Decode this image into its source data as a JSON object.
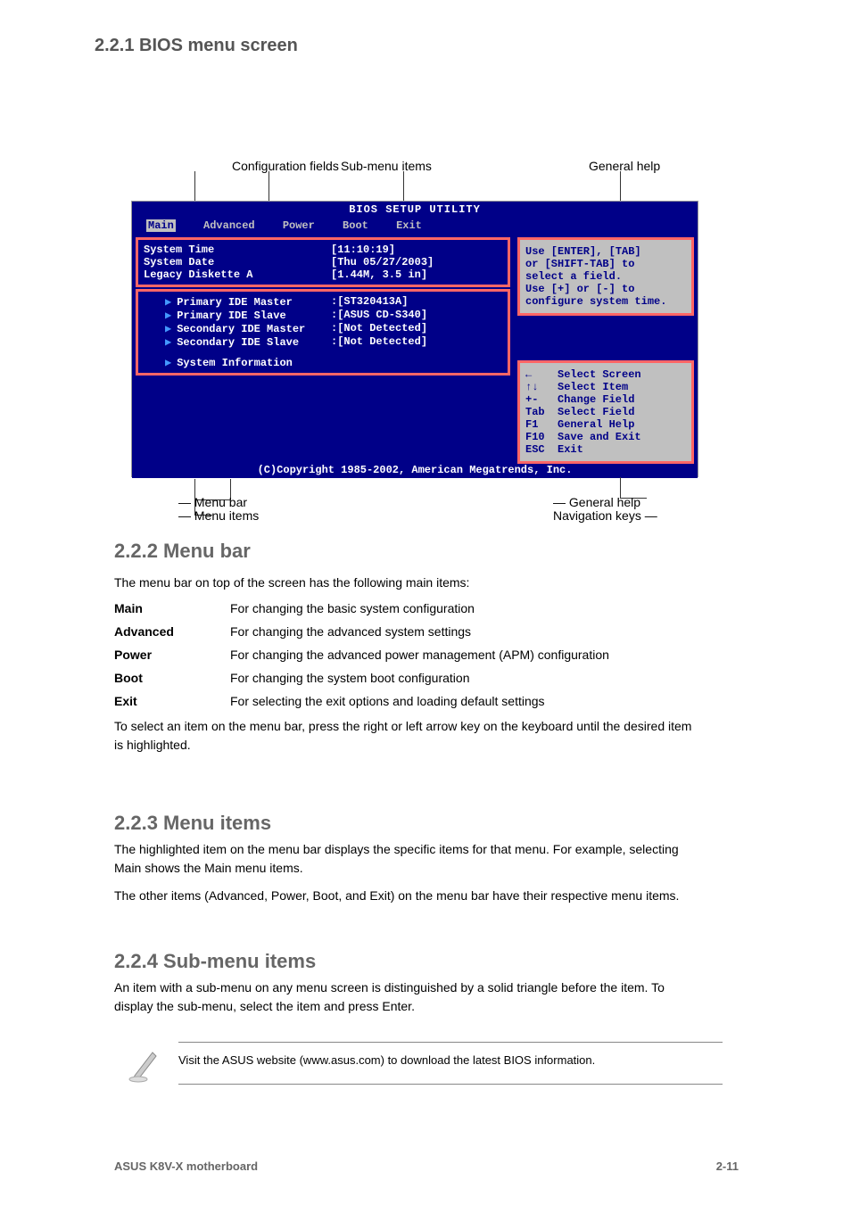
{
  "section_heading": "2.2.1  BIOS menu screen",
  "bios": {
    "title": "BIOS SETUP UTILITY",
    "tabs": [
      "Main",
      "Advanced",
      "Power",
      "Boot",
      "Exit"
    ],
    "left_top": [
      {
        "label": "System Time",
        "value": "[11:10:19]"
      },
      {
        "label": "System Date",
        "value": "[Thu 05/27/2003]"
      },
      {
        "label": "Legacy Diskette A",
        "value": "[1.44M, 3.5 in]"
      }
    ],
    "left_mid": [
      {
        "label": "Primary IDE Master",
        "value": ":[ST320413A]"
      },
      {
        "label": "Primary IDE Slave",
        "value": ":[ASUS CD-S340]"
      },
      {
        "label": "Secondary IDE Master",
        "value": ":[Not Detected]"
      },
      {
        "label": "Secondary IDE Slave",
        "value": ":[Not Detected]"
      }
    ],
    "sysinfo_label": "System Information",
    "help_lines": [
      "Use [ENTER], [TAB]",
      "or [SHIFT-TAB] to",
      "select a field.",
      "",
      "Use [+] or [-] to",
      "configure system time."
    ],
    "nav": [
      {
        "key": "←",
        "label": "Select Screen"
      },
      {
        "key": "↑↓",
        "label": "Select Item"
      },
      {
        "key": "+-",
        "label": "Change Field"
      },
      {
        "key": "Tab",
        "label": "Select Field"
      },
      {
        "key": "F1",
        "label": "General Help"
      },
      {
        "key": "F10",
        "label": "Save and Exit"
      },
      {
        "key": "ESC",
        "label": "Exit"
      }
    ],
    "footer": "(C)Copyright 1985-2002, American Megatrends, Inc."
  },
  "callouts": {
    "menubar": "Menu bar",
    "menuitems": "Menu items",
    "config": "Configuration fields",
    "submenu": "Sub-menu items",
    "general": "General help",
    "navkeys": "Navigation keys"
  },
  "menubar": {
    "heading": "2.2.2  Menu bar",
    "intro": "The menu bar on top of the screen has the following main items:",
    "rows": [
      {
        "key": "Main",
        "val": "For changing the basic system configuration"
      },
      {
        "key": "Advanced",
        "val": "For changing the advanced system settings"
      },
      {
        "key": "Power",
        "val": "For changing the advanced power management (APM) configuration"
      },
      {
        "key": "Boot",
        "val": "For changing the system boot configuration"
      },
      {
        "key": "Exit",
        "val": "For selecting the exit options and loading default settings"
      }
    ],
    "outro": "To select an item on the menu bar, press the right or left arrow key on the keyboard until the desired item is highlighted."
  },
  "menuitems_section": {
    "heading": "2.2.3  Menu items",
    "p1": "The highlighted item on the menu bar displays the specific items for that menu. For example, selecting Main shows the Main menu items.",
    "p2": "The other items (Advanced, Power, Boot, and Exit) on the menu bar have their respective menu items."
  },
  "submenu_section": {
    "heading": "2.2.4  Sub-menu items",
    "p1": "An item with a sub-menu on any menu screen is distinguished by a solid triangle before the item. To display the sub-menu, select the item and press Enter."
  },
  "note": "Visit the ASUS website (www.asus.com) to download the latest BIOS information.",
  "footer": {
    "left": "ASUS K8V-X motherboard",
    "right": "2-11"
  }
}
